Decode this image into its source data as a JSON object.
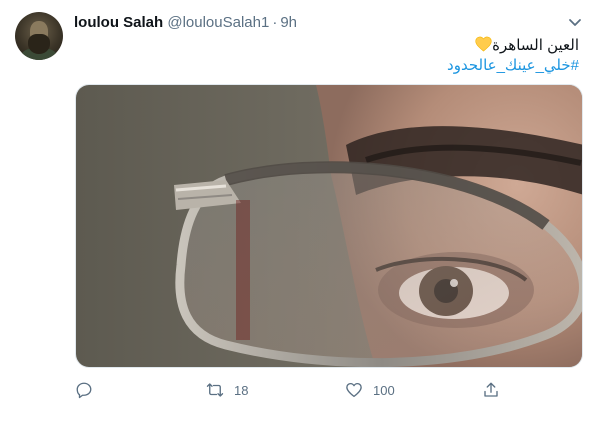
{
  "tweet": {
    "author_name": "loulou Salah",
    "handle": "@loulouSalah1",
    "separator": "·",
    "time": "9h",
    "text_line1": "العين الساهرة",
    "text_line2": "#خلي_عينك_عالحدود",
    "emoji": "yellow-heart",
    "colors": {
      "text": "#0f1419",
      "secondary": "#5b7083",
      "hashtag": "#1b95e0",
      "heart": "#ffcc4d"
    }
  },
  "actions": {
    "reply": {
      "icon": "reply-icon",
      "count": ""
    },
    "retweet": {
      "icon": "retweet-icon",
      "count": "18"
    },
    "like": {
      "icon": "heart-icon",
      "count": "100"
    },
    "share": {
      "icon": "share-icon",
      "count": ""
    }
  }
}
